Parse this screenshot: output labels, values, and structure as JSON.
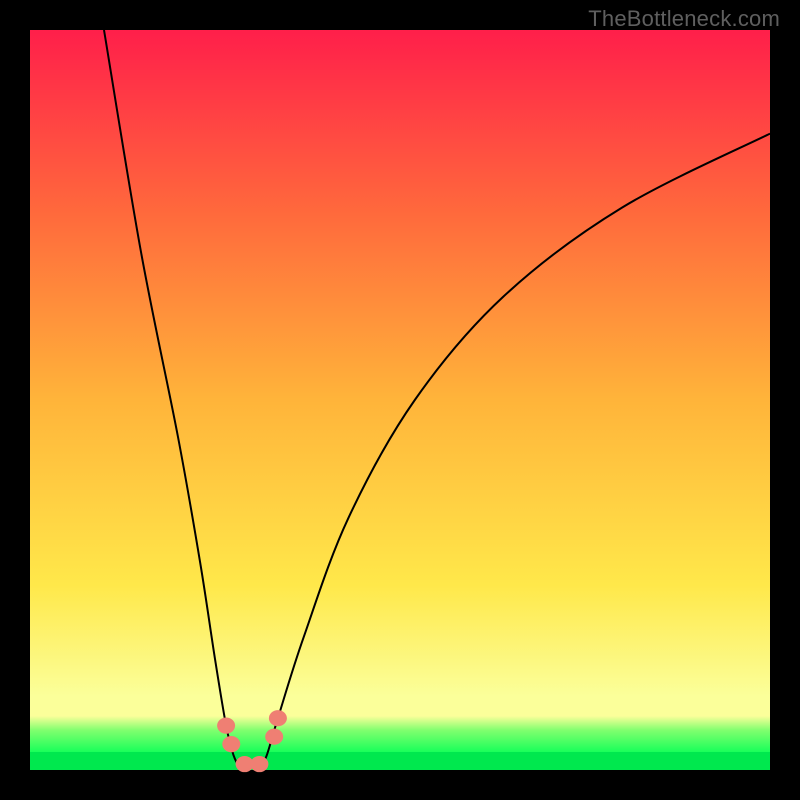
{
  "watermark": "TheBottleneck.com",
  "colors": {
    "top": "#ff1f4a",
    "q1": "#ff6a3c",
    "mid": "#ffb43a",
    "q3": "#ffe84a",
    "band_top": "#fbff9a",
    "green_mid": "#7fff6e",
    "green": "#19ff5a",
    "green_deep": "#00e84e",
    "marker": "#ef7f73"
  },
  "chart_data": {
    "type": "line",
    "title": "",
    "xlabel": "",
    "ylabel": "",
    "xlim": [
      0,
      100
    ],
    "ylim": [
      0,
      100
    ],
    "curves": [
      {
        "name": "left-branch",
        "points": [
          {
            "x": 10,
            "y": 100
          },
          {
            "x": 15,
            "y": 70
          },
          {
            "x": 20,
            "y": 45
          },
          {
            "x": 23,
            "y": 28
          },
          {
            "x": 25,
            "y": 15
          },
          {
            "x": 26.5,
            "y": 6
          },
          {
            "x": 27.5,
            "y": 2
          },
          {
            "x": 28.5,
            "y": 0
          }
        ]
      },
      {
        "name": "right-branch",
        "points": [
          {
            "x": 31,
            "y": 0
          },
          {
            "x": 32,
            "y": 2
          },
          {
            "x": 33.5,
            "y": 7
          },
          {
            "x": 37,
            "y": 18
          },
          {
            "x": 43,
            "y": 34
          },
          {
            "x": 52,
            "y": 50
          },
          {
            "x": 64,
            "y": 64
          },
          {
            "x": 80,
            "y": 76
          },
          {
            "x": 100,
            "y": 86
          }
        ]
      }
    ],
    "markers": [
      {
        "x": 26.5,
        "y": 6
      },
      {
        "x": 27.2,
        "y": 3.5
      },
      {
        "x": 29.0,
        "y": 0.8
      },
      {
        "x": 31.0,
        "y": 0.8
      },
      {
        "x": 33.0,
        "y": 4.5
      },
      {
        "x": 33.5,
        "y": 7
      }
    ]
  }
}
